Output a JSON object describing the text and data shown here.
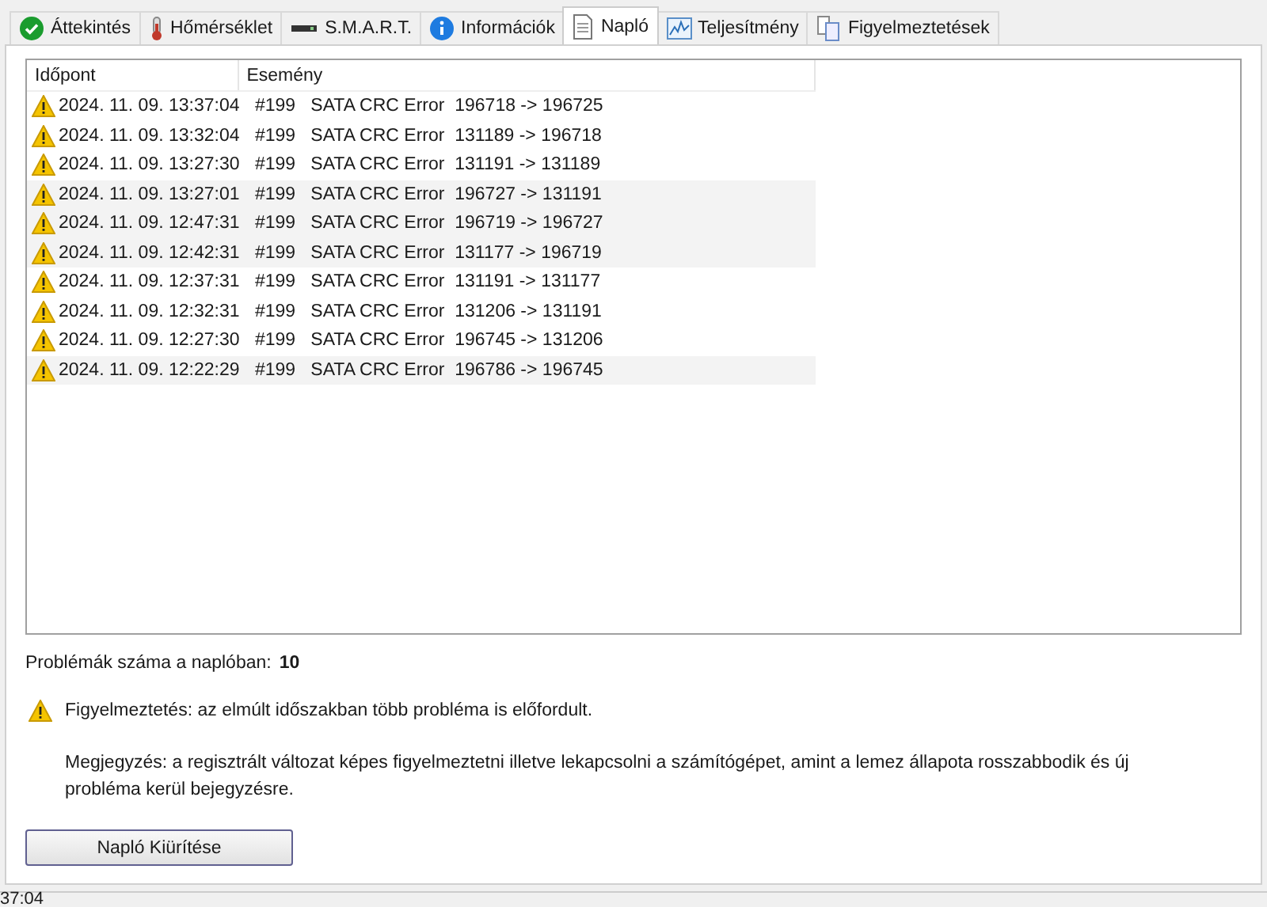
{
  "tabs": [
    {
      "label": "Áttekintés",
      "kind": "check",
      "selected": false
    },
    {
      "label": "Hőmérséklet",
      "kind": "thermometer",
      "selected": false
    },
    {
      "label": "S.M.A.R.T.",
      "kind": "drive",
      "selected": false
    },
    {
      "label": "Információk",
      "kind": "info",
      "selected": false
    },
    {
      "label": "Napló",
      "kind": "document",
      "selected": true
    },
    {
      "label": "Teljesítmény",
      "kind": "chart",
      "selected": false
    },
    {
      "label": "Figyelmeztetések",
      "kind": "copy",
      "selected": false
    }
  ],
  "table": {
    "columns": [
      "Időpont",
      "Esemény"
    ],
    "rows": [
      {
        "time": "2024. 11. 09. 13:37:04",
        "event": "#199   SATA CRC Error  196718 -> 196725",
        "shaded": false
      },
      {
        "time": "2024. 11. 09. 13:32:04",
        "event": "#199   SATA CRC Error  131189 -> 196718",
        "shaded": false
      },
      {
        "time": "2024. 11. 09. 13:27:30",
        "event": "#199   SATA CRC Error  131191 -> 131189",
        "shaded": false
      },
      {
        "time": "2024. 11. 09. 13:27:01",
        "event": "#199   SATA CRC Error  196727 -> 131191",
        "shaded": true
      },
      {
        "time": "2024. 11. 09. 12:47:31",
        "event": "#199   SATA CRC Error  196719 -> 196727",
        "shaded": true
      },
      {
        "time": "2024. 11. 09. 12:42:31",
        "event": "#199   SATA CRC Error  131177 -> 196719",
        "shaded": true
      },
      {
        "time": "2024. 11. 09. 12:37:31",
        "event": "#199   SATA CRC Error  131191 -> 131177",
        "shaded": false
      },
      {
        "time": "2024. 11. 09. 12:32:31",
        "event": "#199   SATA CRC Error  131206 -> 131191",
        "shaded": false
      },
      {
        "time": "2024. 11. 09. 12:27:30",
        "event": "#199   SATA CRC Error  196745 -> 131206",
        "shaded": false
      },
      {
        "time": "2024. 11. 09. 12:22:29",
        "event": "#199   SATA CRC Error  196786 -> 196745",
        "shaded": true
      }
    ]
  },
  "count_label": "Problémák száma a naplóban:",
  "count_value": "10",
  "warning": "Figyelmeztetés: az elmúlt időszakban több probléma is előfordult.",
  "note": "Megjegyzés: a regisztrált változat képes figyelmeztetni illetve lekapcsolni a számítógépet, amint a lemez állapota rosszabbodik és új probléma kerül bejegyzésre.",
  "clear_button": "Napló Kiürítése",
  "status_bar": "37:04"
}
